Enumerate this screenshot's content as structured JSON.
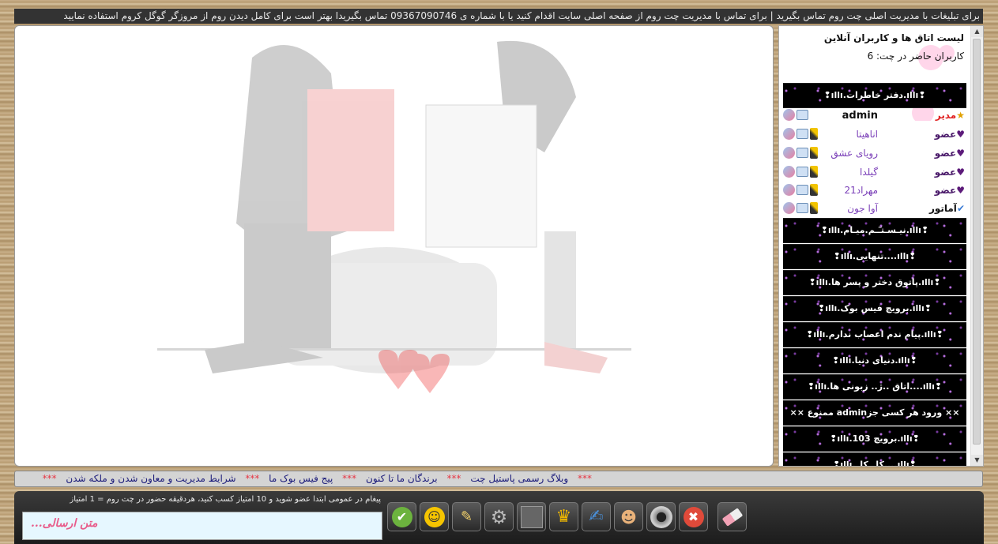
{
  "top_notice": "برای تبلیغات با مدیریت اصلی چت روم تماس بگیرید | برای تماس با مدیریت چت روم از صفحه اصلی سایت اقدام کنید یا با شماره ی 09367090746 تماس بگیریدا بهتر است برای کامل دیدن روم از مروزگر گوگل کروم استفاده نمایید",
  "sidebar": {
    "title": "لیست اتاق ها و کاربران آنلاین",
    "online_count_label": "کاربران حاضر در چت: 6",
    "active_room": "❢ıllı.دفتر خاطرات.ıllı❢",
    "users": [
      {
        "rank": "مدیر",
        "name": "admin",
        "type": "admin"
      },
      {
        "rank": "عضو",
        "name": "اناهیتا",
        "type": "member"
      },
      {
        "rank": "عضو",
        "name": "رویای عشق",
        "type": "member"
      },
      {
        "rank": "عضو",
        "name": "گیلدا",
        "type": "member"
      },
      {
        "rank": "عضو",
        "name": "مهراد21",
        "type": "member"
      },
      {
        "rank": "آماتور",
        "name": "آوا جون",
        "type": "amateur"
      }
    ],
    "rooms": [
      "❢ıllı.نیـسـتـٓـم.میـام.ıllı❢",
      "❢ıllı....تنهایی.ıllı❢",
      "❢ıllı.پاتوق دختر و پسر ها.ıllı❢",
      "❢ıllı.برویچ فیس بوک.ıllı❢",
      "❢ıllı.پیام ندم اعصاب ندارم.ıllı❢",
      "❢ıllı.دنیای دنیا.ıllı❢",
      "❢ıllı....اتاق ..ژ.. زبونی ها.ıllı❢",
      "×× ورود هر کسی جزadmin ممنوع ××",
      "❢ıllı.برویچ 103.ıllı❢",
      "❢ıllı....کل کل.ıllı❢"
    ]
  },
  "marquee": {
    "items": [
      "وبلاگ رسمی پاستیل چت",
      "برندگان ما تا کنون",
      "پیج فیس بوک ما",
      "شرایط مدیریت و معاون شدن و ملکه شدن"
    ],
    "separator": "***"
  },
  "composer": {
    "hint": "پیغام در عمومی ابتدا عضو شوید و 10 امتیاز کسب کنید، هردقیقه حضور در چت روم = 1 امتیاز",
    "placeholder": "متن ارسالی..."
  },
  "toolbar": {
    "icons": [
      "check-icon",
      "smiley-icon",
      "brushes-icon",
      "gear-icon",
      "photo-icon",
      "trophy-icon",
      "user-edit-icon",
      "users-icon",
      "speaker-icon",
      "close-icon",
      "eraser-icon"
    ]
  },
  "colors": {
    "member_name": "#7a3fb8",
    "admin_rank": "#e02020",
    "separator": "#e63946",
    "input_text": "#e85a8a"
  }
}
